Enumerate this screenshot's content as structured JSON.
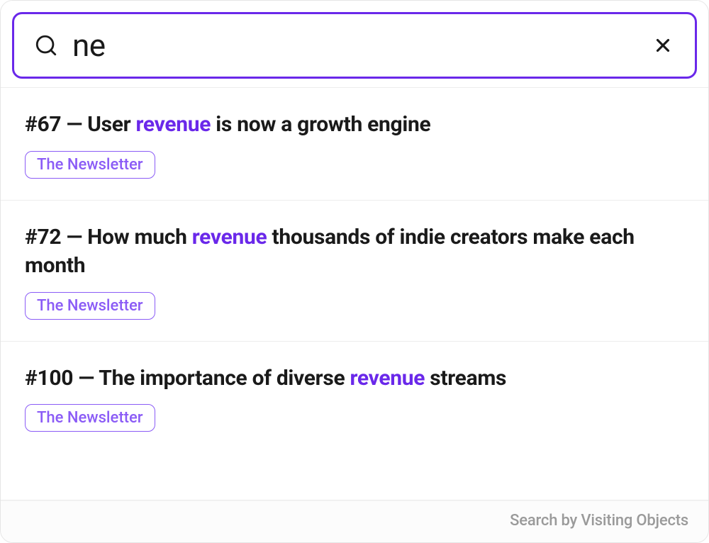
{
  "search": {
    "value": "ne",
    "placeholder": ""
  },
  "results": [
    {
      "prefix": "#67 — User ",
      "highlight": "revenue",
      "suffix": " is now a growth engine",
      "tag": "The Newsletter"
    },
    {
      "prefix": "#72 — How much ",
      "highlight": "revenue",
      "suffix": " thousands of indie creators make each month",
      "tag": "The Newsletter"
    },
    {
      "prefix": "#100 — The importance of diverse ",
      "highlight": "revenue",
      "suffix": " streams",
      "tag": "The Newsletter"
    }
  ],
  "footer": {
    "attribution": "Search by Visiting Objects"
  }
}
